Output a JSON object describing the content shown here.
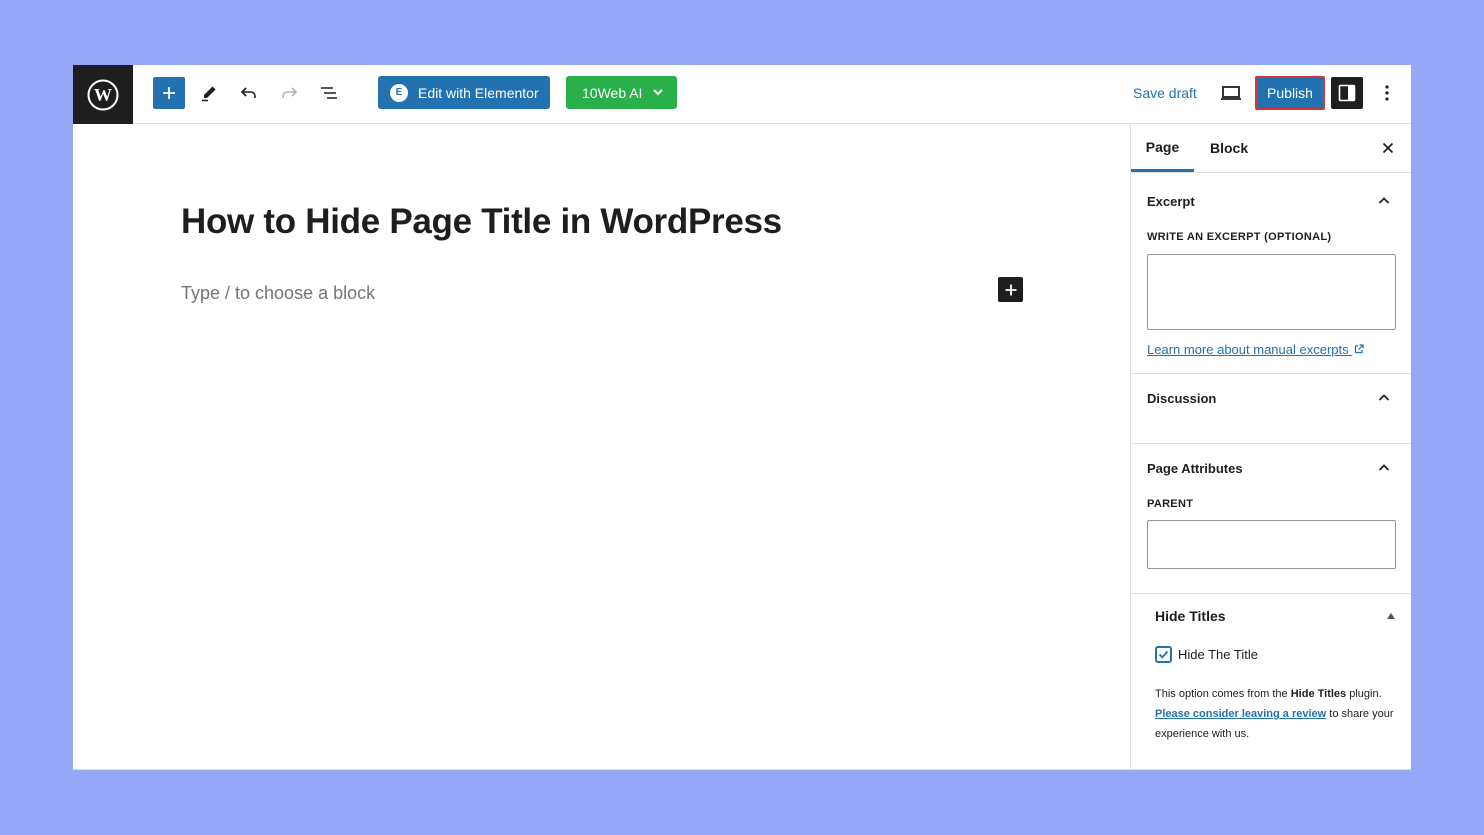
{
  "toolbar": {
    "edit_elementor_label": "Edit with Elementor",
    "elementor_icon_glyph": "E",
    "tenweb_label": "10Web AI",
    "save_draft_label": "Save draft",
    "publish_label": "Publish"
  },
  "editor": {
    "post_title": "How to Hide Page Title in WordPress",
    "block_placeholder": "Type / to choose a block"
  },
  "sidebar": {
    "tabs": [
      {
        "label": "Page",
        "active": true
      },
      {
        "label": "Block",
        "active": false
      }
    ],
    "excerpt": {
      "heading": "Excerpt",
      "field_label": "WRITE AN EXCERPT (OPTIONAL)",
      "value": "",
      "learn_link": "Learn more about manual excerpts"
    },
    "discussion": {
      "heading": "Discussion"
    },
    "page_attributes": {
      "heading": "Page Attributes",
      "parent_label": "PARENT",
      "parent_value": ""
    },
    "hide_titles": {
      "heading": "Hide Titles",
      "checkbox_label": "Hide The Title",
      "checked": true,
      "help_prefix": "This option comes from the ",
      "help_plugin": "Hide Titles",
      "help_mid": " plugin. ",
      "help_link": "Please consider leaving a review",
      "help_suffix": " to share your experience with us."
    }
  },
  "colors": {
    "background": "#95a8f7",
    "accent": "#2271b1",
    "tenweb_green": "#2ab04a",
    "publish_outline": "#d63638",
    "dark": "#1e1e1e"
  }
}
